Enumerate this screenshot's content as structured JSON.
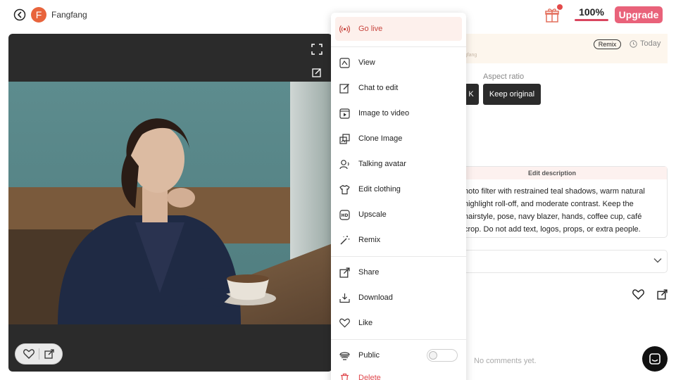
{
  "header": {
    "avatar_letter": "F",
    "username": "Fangfang",
    "credits": "100%",
    "upgrade_label": "Upgrade"
  },
  "details": {
    "remix_tag": "Remix",
    "date": "Today",
    "owner_faint": "fangfang",
    "aspect_label": "Aspect ratio",
    "aspect_partial": "K",
    "keep_original_label": "Keep original",
    "edit_description_title": "Edit description",
    "description_lines": [
      "hoto filter with restrained teal shadows, warm natural",
      "highlight roll-off, and moderate contrast. Keep the",
      "hairstyle, pose, navy blazer, hands, coffee cup, café",
      "crop. Do not add text, logos, props, or extra people."
    ],
    "no_comments": "No comments yet."
  },
  "menu": {
    "items": [
      {
        "label": "Go live",
        "icon": "broadcast-icon"
      },
      {
        "label": "View",
        "icon": "view-icon"
      },
      {
        "label": "Chat to edit",
        "icon": "edit-icon"
      },
      {
        "label": "Image to video",
        "icon": "video-icon"
      },
      {
        "label": "Clone Image",
        "icon": "clone-icon"
      },
      {
        "label": "Talking avatar",
        "icon": "avatar-icon"
      },
      {
        "label": "Edit clothing",
        "icon": "shirt-icon"
      },
      {
        "label": "Upscale",
        "icon": "hd-icon"
      },
      {
        "label": "Remix",
        "icon": "wand-icon"
      },
      {
        "label": "Share",
        "icon": "share-icon"
      },
      {
        "label": "Download",
        "icon": "download-icon"
      },
      {
        "label": "Like",
        "icon": "heart-icon"
      },
      {
        "label": "Public",
        "icon": "globe-icon"
      },
      {
        "label": "Delete",
        "icon": "trash-icon"
      }
    ],
    "public_toggle_on": false
  },
  "colors": {
    "accent": "#e9627a",
    "danger": "#e0484e",
    "live": "#c8463f"
  }
}
